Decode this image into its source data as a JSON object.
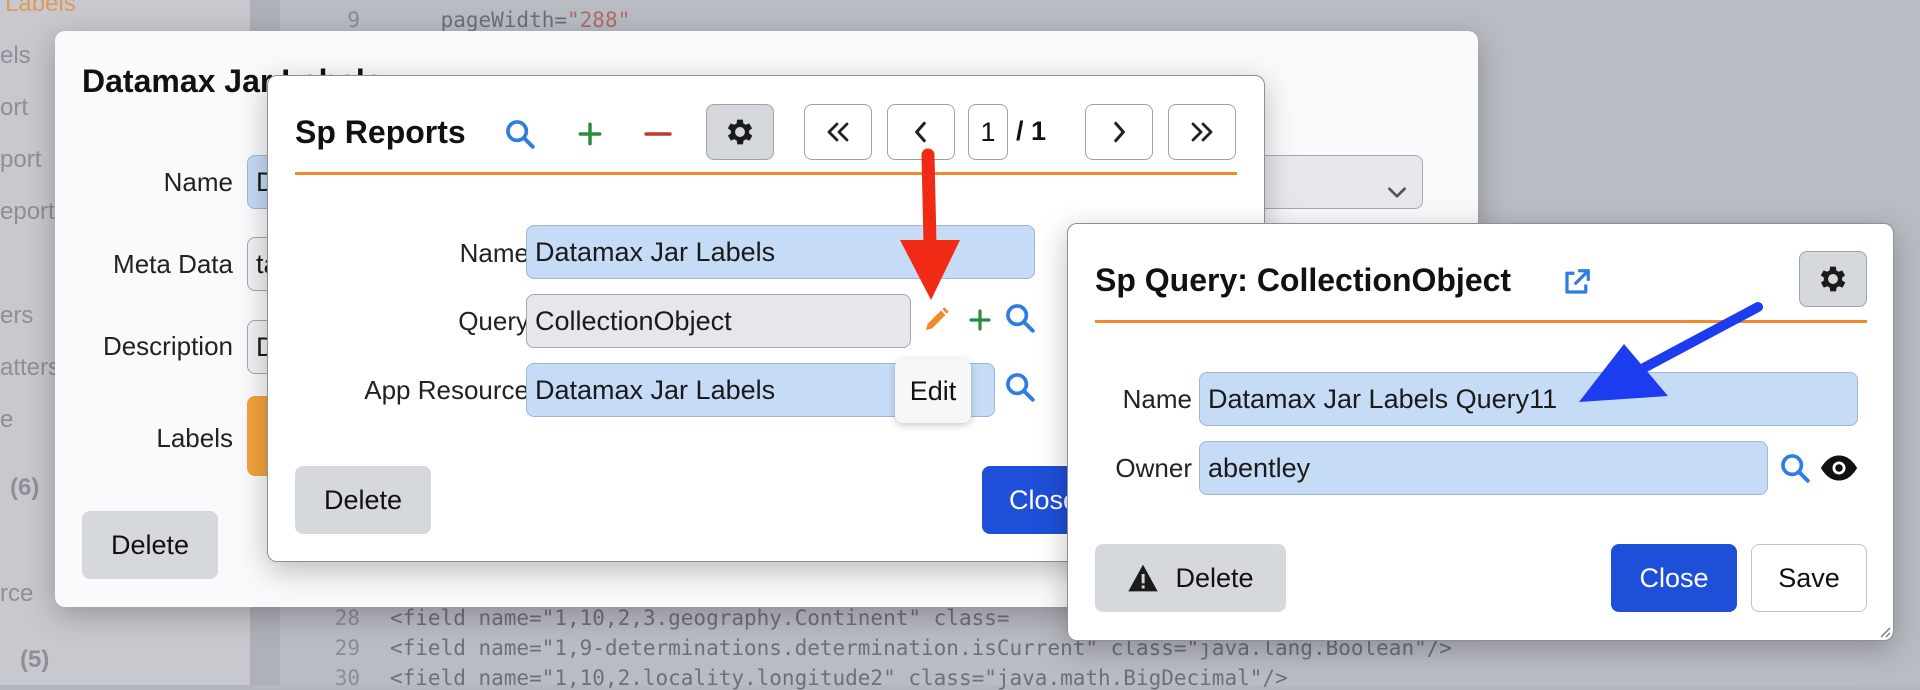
{
  "background": {
    "sidebar_items": [
      {
        "text": "Labels",
        "style": "orange"
      },
      {
        "text": "els",
        "style": ""
      },
      {
        "text": "ort",
        "style": ""
      },
      {
        "text": "port",
        "style": ""
      },
      {
        "text": "eport",
        "style": ""
      },
      {
        "text": "ers",
        "style": ""
      },
      {
        "text": "atters",
        "style": ""
      },
      {
        "text": "e",
        "style": ""
      },
      {
        "text": "(6)",
        "style": "count"
      },
      {
        "text": "rce",
        "style": ""
      },
      {
        "text": "(5)",
        "style": "count"
      }
    ],
    "code_lines": [
      {
        "num": "9",
        "pre": "    pageWidth=",
        "str": "\"288\"",
        "post": ""
      },
      {
        "num": "28",
        "pre": "<field name=\"1,10,2,3.geography.Continent\" class=",
        "str": "",
        "post": ""
      },
      {
        "num": "29",
        "pre": "<field name=\"1,9-determinations.determination.isCurrent\" class=\"java.lang.Boolean\"/>",
        "str": "",
        "post": ""
      },
      {
        "num": "30",
        "pre": "<field name=\"1,10,2.locality.longitude2\" class=\"java.math.BigDecimal\"/>",
        "str": "",
        "post": ""
      }
    ]
  },
  "outer_dialog": {
    "title": "Datamax Jar Labels",
    "labels": {
      "name": "Name",
      "meta_data": "Meta Data",
      "description": "Description",
      "labels": "Labels"
    },
    "name_value": "D",
    "meta_value": "ta",
    "desc_value": "D",
    "delete_label": "Delete"
  },
  "reports_dialog": {
    "title": "Sp Reports",
    "pagination": {
      "current": "1",
      "separator": "/",
      "total": "1"
    },
    "labels": {
      "name": "Name",
      "query": "Query",
      "app_resource": "App Resource"
    },
    "name_value": "Datamax Jar Labels",
    "query_value": "CollectionObject",
    "app_resource_value": "Datamax Jar Labels",
    "tooltip": "Edit",
    "delete_label": "Delete",
    "close_label": "Close"
  },
  "query_dialog": {
    "title": "Sp Query: CollectionObject",
    "labels": {
      "name": "Name",
      "owner": "Owner"
    },
    "name_value": "Datamax Jar Labels Query11",
    "owner_value": "abentley",
    "delete_label": "Delete",
    "close_label": "Close",
    "save_label": "Save"
  },
  "colors": {
    "accent_orange": "#f08a2a",
    "primary_blue": "#1d4fd8",
    "search_blue": "#2f7de1",
    "add_green": "#2e8b3e",
    "remove_red": "#c0392b",
    "annotation_red_arrow": "#f02a14",
    "annotation_blue_arrow": "#1c3cf0"
  },
  "icons": [
    "search-icon",
    "plus-icon",
    "minus-icon",
    "gear-icon",
    "first-page-icon",
    "prev-page-icon",
    "next-page-icon",
    "last-page-icon",
    "pencil-icon",
    "external-link-icon",
    "warning-icon",
    "eye-icon",
    "chevron-down-icon"
  ]
}
